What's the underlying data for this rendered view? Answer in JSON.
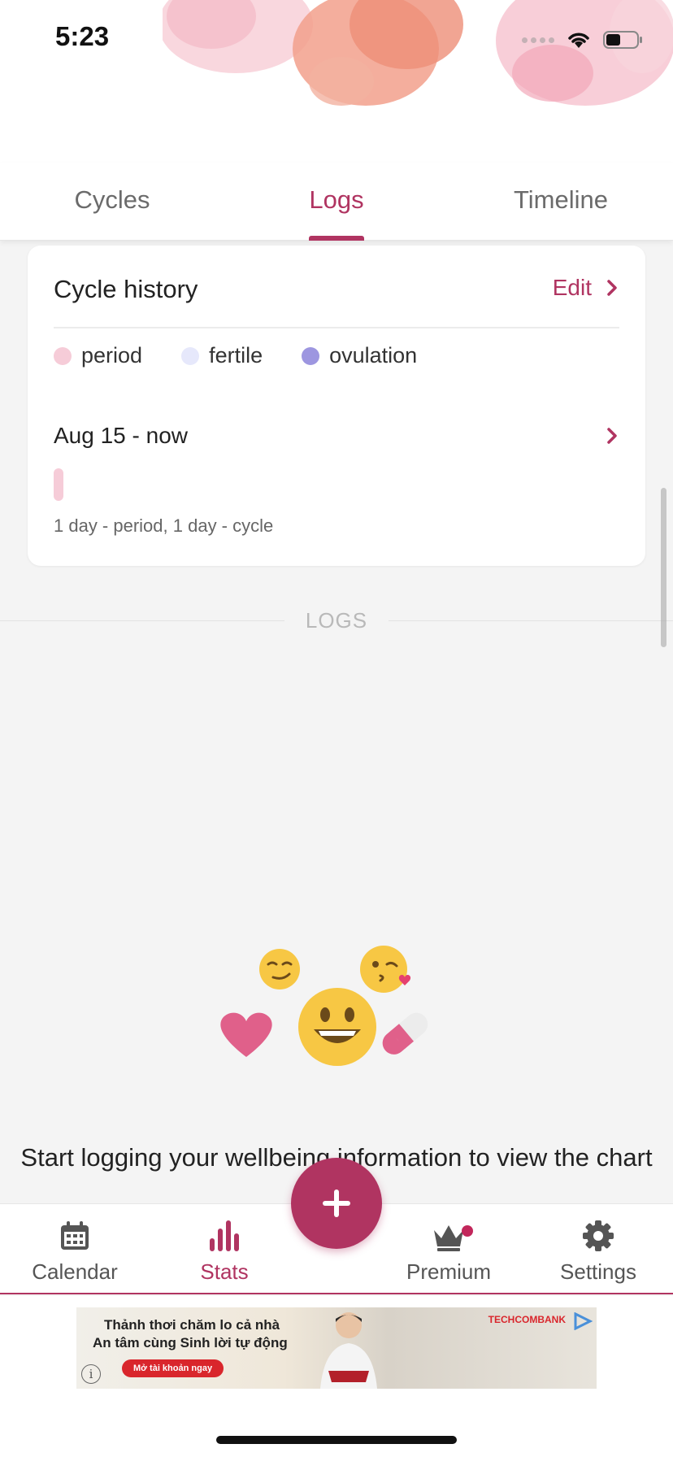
{
  "status_bar": {
    "time": "5:23"
  },
  "tabs": [
    {
      "label": "Cycles",
      "active": false
    },
    {
      "label": "Logs",
      "active": true
    },
    {
      "label": "Timeline",
      "active": false
    }
  ],
  "cycle_card": {
    "title": "Cycle history",
    "edit_label": "Edit",
    "legend": [
      {
        "label": "period",
        "color": "#f6ccd8"
      },
      {
        "label": "fertile",
        "color": "#e6e8fb"
      },
      {
        "label": "ovulation",
        "color": "#9d96e0"
      }
    ],
    "range": "Aug 15 - now",
    "summary": "1 day - period, 1 day - cycle"
  },
  "logs_section": {
    "divider_label": "LOGS",
    "empty_message": "Start logging your wellbeing information to view the chart",
    "icons": [
      "smirk-emoji",
      "kiss-emoji",
      "heart-icon",
      "smile-emoji",
      "pill-icon"
    ]
  },
  "bottom_nav": [
    {
      "label": "Calendar",
      "icon": "calendar-icon",
      "active": false
    },
    {
      "label": "Stats",
      "icon": "bar-chart-icon",
      "active": true
    },
    {
      "label": "Premium",
      "icon": "crown-icon",
      "active": false,
      "badge": true
    },
    {
      "label": "Settings",
      "icon": "gear-icon",
      "active": false
    }
  ],
  "fab": {
    "icon": "plus-icon"
  },
  "ad": {
    "line1": "Thảnh thơi chăm lo cả nhà",
    "line2": "An tâm cùng Sinh lời tự động",
    "cta": "Mở tài khoản ngay",
    "brand": "TECHCOMBANK"
  },
  "colors": {
    "accent": "#b03461",
    "background": "#f4f4f4"
  }
}
